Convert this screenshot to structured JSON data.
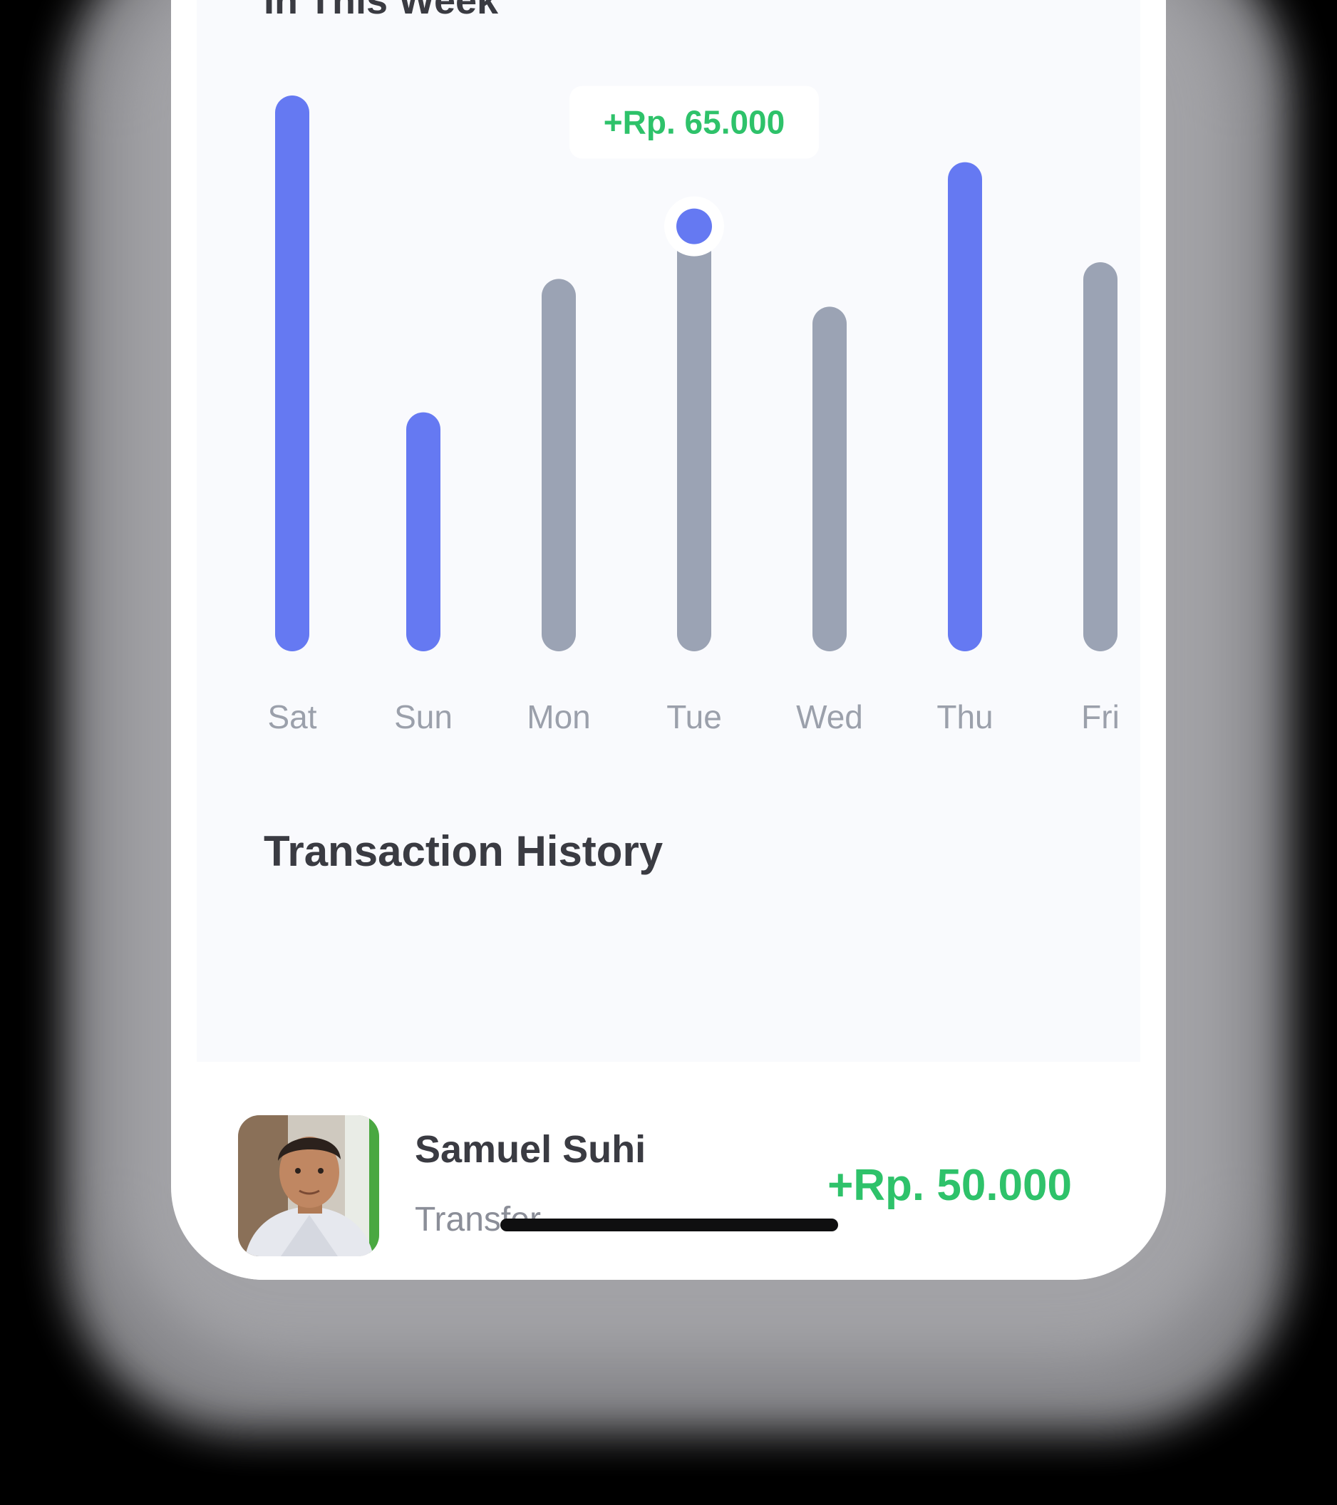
{
  "chart_section": {
    "title": "In This Week"
  },
  "chart_data": {
    "type": "bar",
    "categories": [
      "Sat",
      "Sun",
      "Mon",
      "Tue",
      "Wed",
      "Thu",
      "Fri"
    ],
    "values": [
      100,
      43,
      67,
      78,
      62,
      88,
      70
    ],
    "highlighted": [
      true,
      true,
      false,
      false,
      false,
      true,
      false
    ],
    "selected_index": 3,
    "tooltip": "+Rp. 65.000",
    "colors": {
      "highlight": "#6579f2",
      "default": "#9ba3b4",
      "tooltip_text": "#2ec26a"
    }
  },
  "transactions": {
    "title": "Transaction History",
    "items": [
      {
        "name": "Samuel Suhi",
        "type": "Transfer",
        "amount": "+Rp. 50.000"
      }
    ]
  },
  "colors": {
    "amount_positive": "#2ec26a",
    "text_dark": "#3a3b42",
    "text_muted": "#8b8e98"
  }
}
